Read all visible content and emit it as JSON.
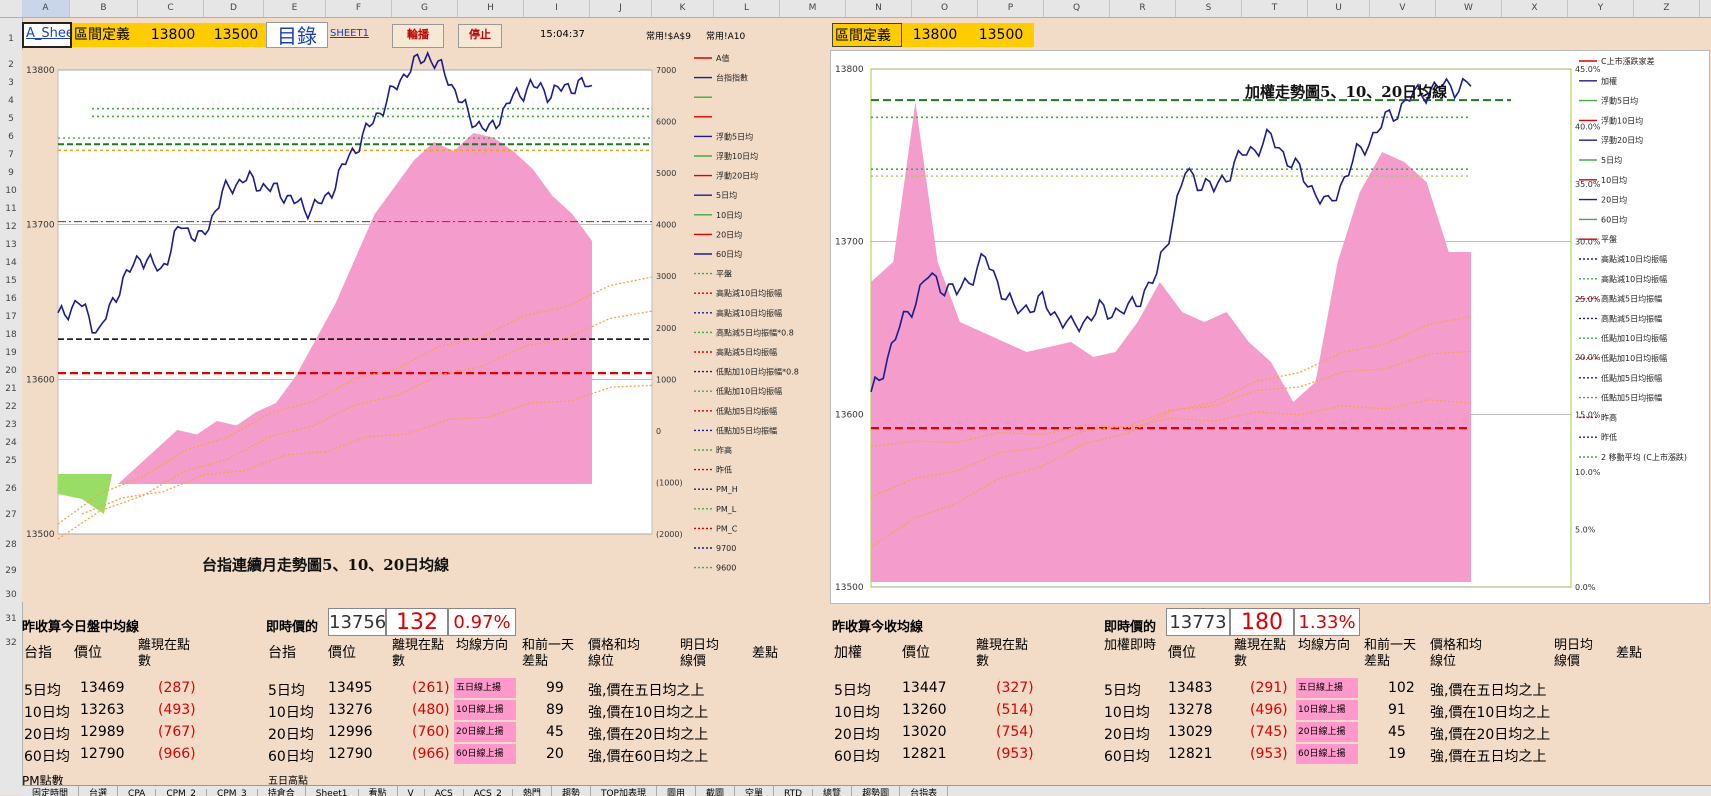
{
  "columns": [
    "A",
    "B",
    "C",
    "D",
    "E",
    "F",
    "G",
    "H",
    "I",
    "J",
    "K",
    "L",
    "M",
    "N",
    "O",
    "P",
    "Q",
    "R",
    "S",
    "T",
    "U",
    "V",
    "W",
    "X",
    "Y",
    "Z"
  ],
  "rows": [
    "1",
    "2",
    "3",
    "4",
    "5",
    "6",
    "7",
    "9",
    "10",
    "11",
    "12",
    "13",
    "14",
    "15",
    "16",
    "17",
    "18",
    "19",
    "20",
    "21",
    "22",
    "23",
    "24",
    "25",
    "26",
    "27",
    "28",
    "29",
    "30",
    "31",
    "32"
  ],
  "topbar": {
    "cell_a1": "A_Shee",
    "range_label": "區間定義",
    "range_high": "13800",
    "range_low": "13500",
    "catalog": "目錄",
    "sheet_link": "SHEET1",
    "btn_rotate": "輪播",
    "btn_stop": "停止",
    "time": "15:04:37",
    "common1": "常用!$A$9",
    "common2": "常用!A10",
    "right_range_label": "區間定義",
    "right_range_high": "13800",
    "right_range_low": "13500"
  },
  "chart_data": [
    {
      "type": "line",
      "title": "台指連續月走勢圖5、10、20日均線",
      "ylim": [
        13500,
        13800
      ],
      "y_ticks": [
        "13800",
        "13700",
        "13600",
        "13500"
      ],
      "y2_ticks": [
        "7000",
        "6000",
        "5000",
        "4000",
        "3000",
        "2000",
        "1000",
        "0",
        "(1000)",
        "(2000)"
      ],
      "legend": [
        "A值",
        "台指指數",
        "",
        "",
        "浮動5日均",
        "浮動10日均",
        "浮動20日均",
        "5日均",
        "10日均",
        "20日均",
        "60日均",
        "平盤",
        "高點減10日均振幅",
        "高點減10日均振幅",
        "高點減5日均振幅*0.8",
        "高點減5日均振幅",
        "低點加10日均振幅*0.8",
        "低點加10日均振幅",
        "低點加5日均振幅",
        "低點加5日均振幅",
        "昨高",
        "昨低",
        "PM_H",
        "PM_L",
        "PM_C",
        "9700",
        "9600"
      ],
      "series": [
        {
          "name": "台指指數",
          "values": [
            13640,
            13650,
            13630,
            13660,
            13680,
            13670,
            13700,
            13690,
            13720,
            13730,
            13725,
            13720,
            13710,
            13715,
            13740,
            13760,
            13780,
            13800,
            13810,
            13795,
            13770,
            13760,
            13780,
            13790,
            13785,
            13790,
            13790
          ]
        }
      ],
      "levels": {
        "平盤": 13626,
        "昨低": 13604,
        "昨高": 13752
      }
    },
    {
      "type": "line",
      "title": "加權走勢圖5、10、20日均線",
      "ylim": [
        13500,
        13800
      ],
      "y_ticks": [
        "13800",
        "13700",
        "13600",
        "13500"
      ],
      "y2_ticks": [
        "45.0%",
        "40.0%",
        "35.0%",
        "30.0%",
        "25.0%",
        "20.0%",
        "15.0%",
        "10.0%",
        "5.0%",
        "0.0%"
      ],
      "legend": [
        "C上市漲跌家差",
        "加權",
        "浮動5日均",
        "浮動10日均",
        "浮動20日均",
        "5日均",
        "10日均",
        "20日均",
        "60日均",
        "平盤",
        "高點減10日均振幅",
        "高點減10日均振幅",
        "高點減5日均振幅",
        "高點減5日均振幅",
        "低點加10日均振幅",
        "低點加10日均振幅",
        "低點加5日均振幅",
        "低點加5日均振幅",
        "昨高",
        "昨低",
        "2 移動平均 (C上市漲跌)"
      ],
      "series": [
        {
          "name": "加權",
          "values": [
            13610,
            13650,
            13680,
            13670,
            13690,
            13660,
            13665,
            13650,
            13660,
            13660,
            13680,
            13740,
            13730,
            13750,
            13760,
            13740,
            13720,
            13750,
            13770,
            13785,
            13790,
            13790
          ]
        }
      ],
      "levels": {
        "昨高": 13782,
        "昨低": 13592
      }
    }
  ],
  "left_table": {
    "title": "昨收算今日盤中均線",
    "headers": [
      "台指",
      "價位",
      "離現在點數"
    ],
    "rows": [
      [
        "5日均",
        "13469",
        "(287)"
      ],
      [
        "10日均",
        "13263",
        "(493)"
      ],
      [
        "20日均",
        "12989",
        "(767)"
      ],
      [
        "60日均",
        "12790",
        "(966)"
      ]
    ],
    "pm_label": "PM點數"
  },
  "mid_table": {
    "label": "即時價的",
    "price": "13756",
    "diff": "132",
    "pct": "0.97%",
    "headers": [
      "台指",
      "價位",
      "離現在點數",
      "均線方向",
      "和前一天差點",
      "價格和均線位",
      "明日均線價",
      "差點"
    ],
    "rows": [
      [
        "5日均",
        "13495",
        "(261)",
        "五日線上揚",
        "99",
        "強,價在五日均之上"
      ],
      [
        "10日均",
        "13276",
        "(480)",
        "10日線上揚",
        "89",
        "強,價在10日均之上"
      ],
      [
        "20日均",
        "12996",
        "(760)",
        "20日線上揚",
        "45",
        "強,價在20日均之上"
      ],
      [
        "60日均",
        "12790",
        "(966)",
        "60日線上揚",
        "20",
        "強,價在60日均之上"
      ]
    ],
    "note": "五日高點"
  },
  "right_table": {
    "title": "昨收算今收均線",
    "headers": [
      "加權",
      "價位",
      "離現在點數"
    ],
    "rows": [
      [
        "5日均",
        "13447",
        "(327)"
      ],
      [
        "10日均",
        "13260",
        "(514)"
      ],
      [
        "20日均",
        "13020",
        "(754)"
      ],
      [
        "60日均",
        "12821",
        "(953)"
      ]
    ]
  },
  "right_mid_table": {
    "label": "即時價的",
    "price": "13773",
    "diff": "180",
    "pct": "1.33%",
    "headers": [
      "加權即時",
      "價位",
      "離現在點數",
      "均線方向",
      "和前一天差點",
      "價格和均線位",
      "明日均線價",
      "差點"
    ],
    "rows": [
      [
        "5日均",
        "13483",
        "(291)",
        "五日線上揚",
        "102",
        "強,價在五日均之上"
      ],
      [
        "10日均",
        "13278",
        "(496)",
        "10日線上揚",
        "91",
        "強,價在10日均之上"
      ],
      [
        "20日均",
        "13029",
        "(745)",
        "20日線上揚",
        "45",
        "強,價在20日均之上"
      ],
      [
        "60日均",
        "12821",
        "(953)",
        "60日線上揚",
        "19",
        "強,價在五日均之上"
      ]
    ]
  },
  "sheet_tabs": [
    "固定時間",
    "台選",
    "CPA",
    "CPM_2",
    "CPM_3",
    "持倉合",
    "Sheet1",
    "看點",
    "V",
    "ACS",
    "ACS_2",
    "熱門",
    "趨勢",
    "TOP加表現",
    "圖用",
    "截圖",
    "空單",
    "RTD",
    "總覽",
    "趨勢圖",
    "台指表"
  ],
  "colors": {
    "pink_area": "#f49ccc",
    "index_line": "#1c1c8c",
    "accent_red": "#e00000",
    "header_yellow": "#ffcc00"
  }
}
